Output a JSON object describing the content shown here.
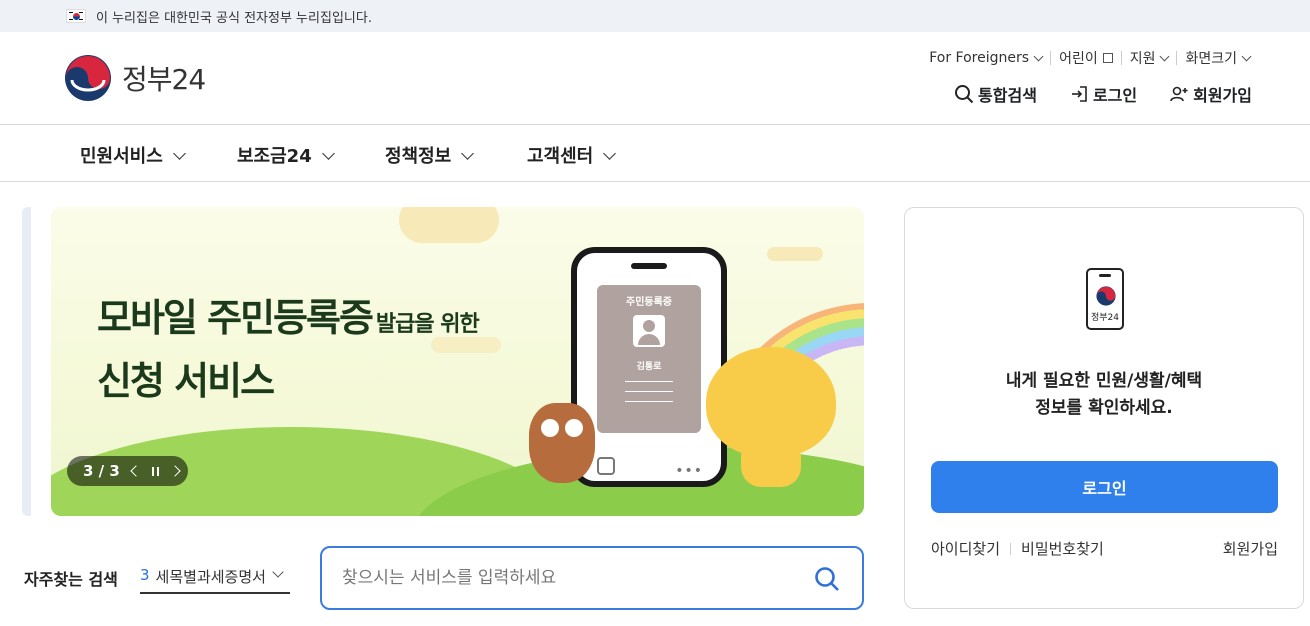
{
  "gov_strip": {
    "text": "이 누리집은 대한민국 공식 전자정부 누리집입니다."
  },
  "logo": {
    "text": "정부24"
  },
  "util_menu": [
    {
      "label": "For Foreigners"
    },
    {
      "label": "어린이"
    },
    {
      "label": "지원"
    },
    {
      "label": "화면크기"
    }
  ],
  "actions": {
    "search": "통합검색",
    "login": "로그인",
    "signup": "회원가입"
  },
  "nav": [
    {
      "label": "민원서비스"
    },
    {
      "label": "보조금24"
    },
    {
      "label": "정책정보"
    },
    {
      "label": "고객센터"
    }
  ],
  "banner": {
    "line1_main": "모바일 주민등록증",
    "line1_small": "발급을 위한",
    "line2": "신청 서비스",
    "card_title": "주민등록증",
    "card_name": "김통로",
    "slide_counter": "3 / 3"
  },
  "frequent_search": {
    "label": "자주찾는 검색",
    "selected_number": "3",
    "selected_text": "세목별과세증명서",
    "placeholder": "찾으시는 서비스를 입력하세요"
  },
  "login_panel": {
    "device_text": "정부24",
    "message_line1": "내게 필요한 민원/생활/혜택",
    "message_line2": "정보를 확인하세요.",
    "login_button": "로그인",
    "find_id": "아이디찾기",
    "find_password": "비밀번호찾기",
    "signup": "회원가입"
  },
  "colors": {
    "accent": "#2f80ed",
    "search_border": "#3b7be0",
    "strip_bg": "#eef1f6"
  }
}
